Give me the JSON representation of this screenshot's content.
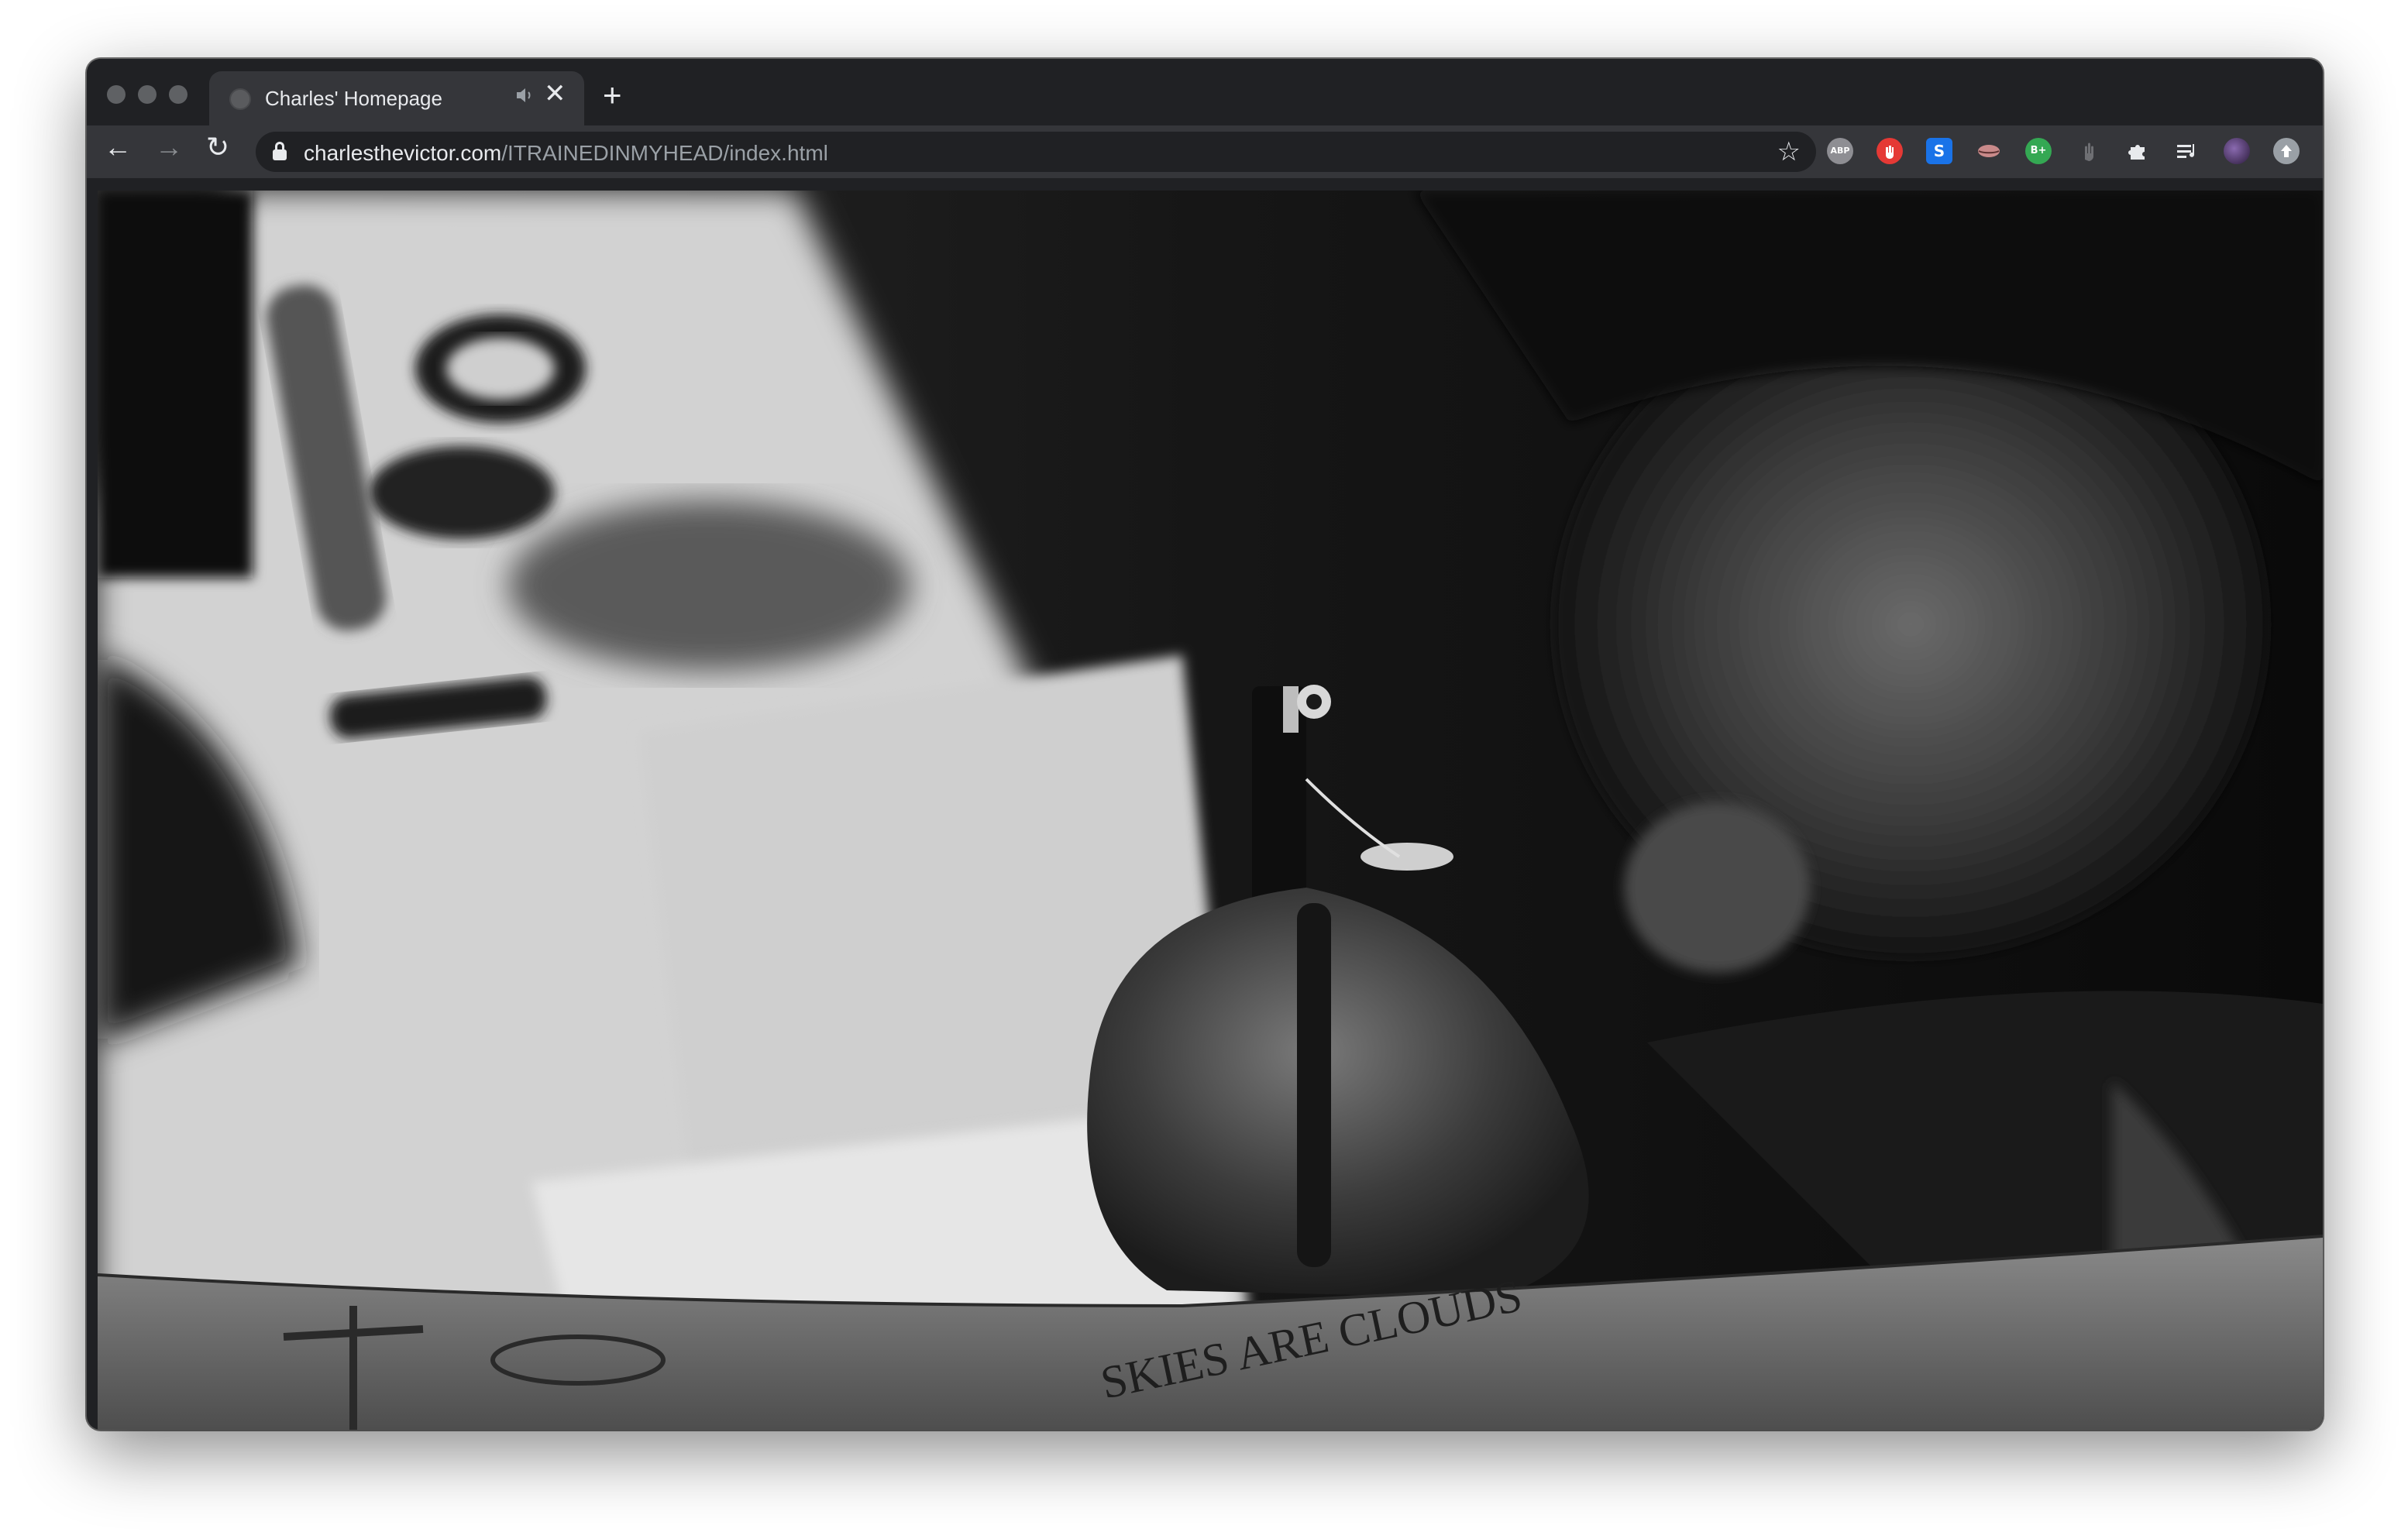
{
  "browser": {
    "tab": {
      "title": "Charles' Homepage",
      "close_symbol": "✕",
      "audio_icon": "speaker-icon",
      "favicon": "globe-icon"
    },
    "new_tab_symbol": "+",
    "nav": {
      "back_symbol": "←",
      "forward_symbol": "→",
      "reload_symbol": "↻"
    },
    "address": {
      "host": "charlesthevictor.com",
      "path": "/ITRAINEDINMYHEAD/index.html"
    },
    "bookmark_symbol": "☆",
    "extensions": [
      {
        "name": "adblock-plus-icon",
        "label": "ABP",
        "color": "#8e8e93"
      },
      {
        "name": "ublock-icon",
        "label": "",
        "color": "#e53935"
      },
      {
        "name": "s-extension-icon",
        "label": "S",
        "color": "#1a73e8"
      },
      {
        "name": "lips-extension-icon",
        "label": "",
        "color": "#e0a0a0"
      },
      {
        "name": "b-plus-icon",
        "label": "B+",
        "color": "#34a853"
      },
      {
        "name": "hand-extension-icon",
        "label": "",
        "color": "#6e6f73"
      },
      {
        "name": "puzzle-icon",
        "label": "",
        "color": "#e8eaed"
      },
      {
        "name": "media-queue-icon",
        "label": "",
        "color": "#e8eaed"
      },
      {
        "name": "profile-avatar",
        "label": "",
        "color": "#4a3a6a"
      },
      {
        "name": "update-icon",
        "label": "",
        "color": "#9aa0a6"
      }
    ]
  },
  "page": {
    "photo_description_name": "tattoo-artist-photo",
    "arm_tattoo_text": "SKIES ARE CLOUDS"
  },
  "colors": {
    "chrome_dark": "#202124",
    "chrome_toolbar": "#35363a",
    "text": "#e8eaed",
    "muted": "#9aa0a6"
  }
}
